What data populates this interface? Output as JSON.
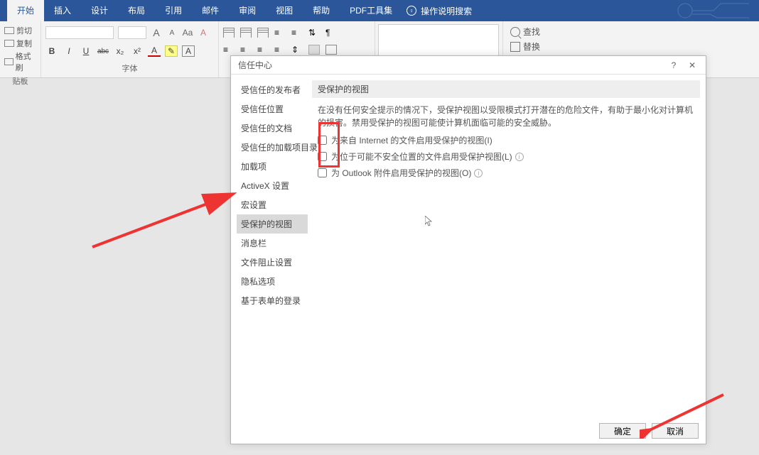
{
  "ribbon": {
    "tabs": [
      "开始",
      "插入",
      "设计",
      "布局",
      "引用",
      "邮件",
      "审阅",
      "视图",
      "帮助",
      "PDF工具集"
    ],
    "active_tab_index": 0,
    "tell_me": "操作说明搜索",
    "clipboard": {
      "cut": "剪切",
      "copy": "复制",
      "painter": "格式刷",
      "group_label": "贴板"
    },
    "font": {
      "bold": "B",
      "italic": "I",
      "underline": "U",
      "strike": "abc",
      "sub": "x₂",
      "sup": "x²",
      "grow": "A",
      "shrink": "A",
      "case": "Aa",
      "clear": "A",
      "group_label": "字体"
    },
    "editing": {
      "find": "查找",
      "replace": "替换"
    }
  },
  "dialog": {
    "title": "信任中心",
    "help_btn": "?",
    "close_btn": "✕",
    "categories": [
      "受信任的发布者",
      "受信任位置",
      "受信任的文档",
      "受信任的加载项目录",
      "加载项",
      "ActiveX 设置",
      "宏设置",
      "受保护的视图",
      "消息栏",
      "文件阻止设置",
      "隐私选项",
      "基于表单的登录"
    ],
    "selected_index": 7,
    "section_title": "受保护的视图",
    "description": "在没有任何安全提示的情况下，受保护视图以受限模式打开潜在的危险文件，有助于最小化对计算机的损害。禁用受保护的视图可能使计算机面临可能的安全威胁。",
    "checkboxes": [
      {
        "label": "为来自 Internet 的文件启用受保护的视图(I)",
        "checked": false,
        "info": false
      },
      {
        "label": "为位于可能不安全位置的文件启用受保护视图(L)",
        "checked": false,
        "info": true
      },
      {
        "label": "为 Outlook 附件启用受保护的视图(O)",
        "checked": false,
        "info": true
      }
    ],
    "ok": "确定",
    "cancel": "取消"
  }
}
